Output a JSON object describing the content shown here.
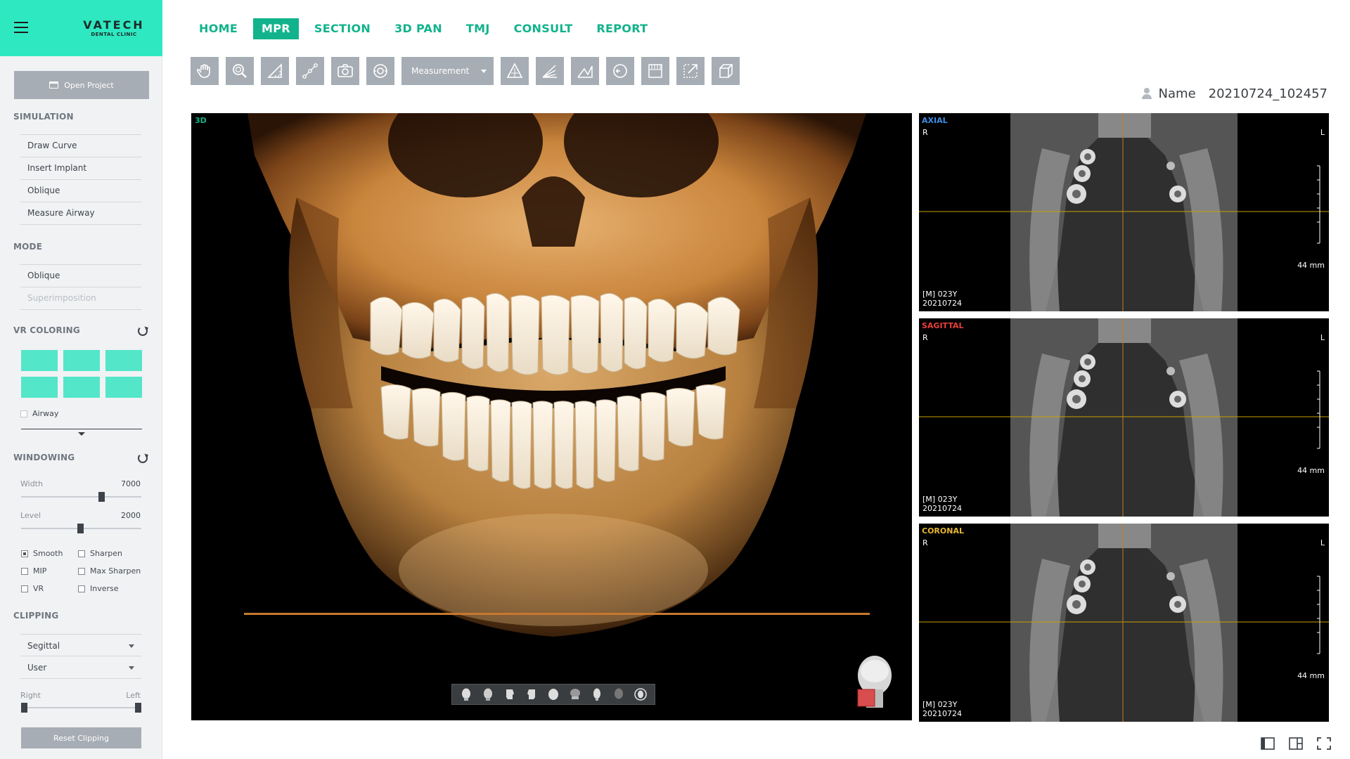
{
  "brand": {
    "name": "VATECH",
    "sub": "DENTAL CLINIC"
  },
  "sidebar": {
    "open_project": "Open Project",
    "simulation": {
      "title": "SIMULATION",
      "items": [
        "Draw Curve",
        "Insert Implant",
        "Oblique",
        "Measure Airway"
      ]
    },
    "mode": {
      "title": "MODE",
      "items": [
        "Oblique",
        "Superimposition"
      ]
    },
    "vr_coloring": {
      "title": "VR COLORING",
      "swatch_color": "#54e6c9",
      "airway_label": "Airway",
      "airway_checked": false
    },
    "windowing": {
      "title": "WINDOWING",
      "width_label": "Width",
      "width_value": "7000",
      "level_label": "Level",
      "level_value": "2000",
      "options": [
        {
          "label": "Smooth",
          "checked": true
        },
        {
          "label": "Sharpen",
          "checked": false
        },
        {
          "label": "MIP",
          "checked": false
        },
        {
          "label": "Max Sharpen",
          "checked": false
        },
        {
          "label": "VR",
          "checked": false
        },
        {
          "label": "Inverse",
          "checked": false
        }
      ]
    },
    "clipping": {
      "title": "CLIPPING",
      "plane": "Segittal",
      "mode": "User",
      "left_end": "Right",
      "right_end": "Left",
      "reset": "Reset Clipping"
    }
  },
  "nav": {
    "tabs": [
      "HOME",
      "MPR",
      "SECTION",
      "3D PAN",
      "TMJ",
      "CONSULT",
      "REPORT"
    ],
    "active": "MPR",
    "accent": "#12b38c"
  },
  "toolbar": {
    "icons": [
      "pan-hand-icon",
      "zoom-icon",
      "ruler-angle-icon",
      "path-line-icon",
      "camera-icon",
      "rotate-view-icon"
    ],
    "measurement_label": "Measurement",
    "icons_after": [
      "triangle-measure-icon",
      "stacked-measure-icon",
      "angle-measure-icon",
      "reset-circle-icon",
      "grid-measure-icon",
      "export-icon",
      "cube-3d-icon"
    ]
  },
  "patient": {
    "name_label": "Name",
    "name_value": "20210724_102457"
  },
  "view3d": {
    "label": "3D",
    "label_color": "#12b38c"
  },
  "mpr_views": [
    {
      "title": "AXIAL",
      "title_color": "#3a8fe8",
      "r": "R",
      "l": "L",
      "scale": "44 mm",
      "patient": "[M] 023Y",
      "date": "20210724"
    },
    {
      "title": "SAGITTAL",
      "title_color": "#e8403a",
      "r": "R",
      "l": "L",
      "scale": "44 mm",
      "patient": "[M] 023Y",
      "date": "20210724"
    },
    {
      "title": "CORONAL",
      "title_color": "#e8b830",
      "r": "R",
      "l": "L",
      "scale": "44 mm",
      "patient": "[M] 023Y",
      "date": "20210724"
    }
  ],
  "layout_icons": [
    "single-panel-layout-icon",
    "split-panel-layout-icon",
    "fullscreen-icon"
  ]
}
